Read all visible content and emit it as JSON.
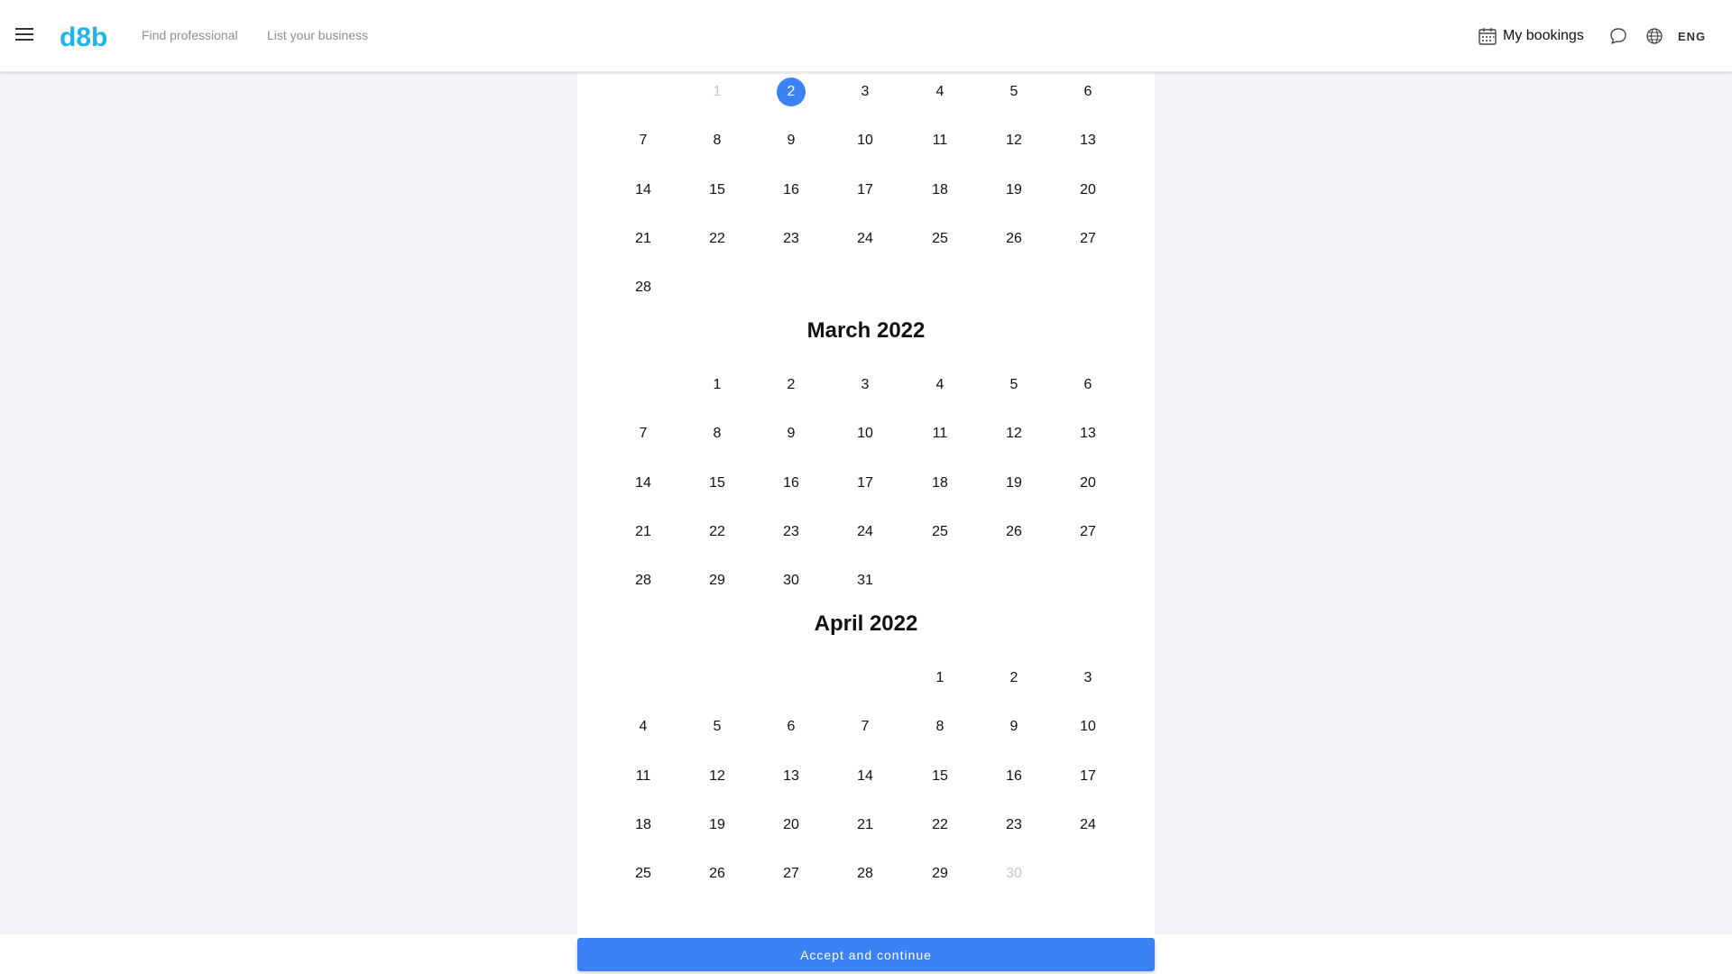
{
  "header": {
    "logo_text": "d8b",
    "nav": {
      "find_professional": "Find professional",
      "list_business": "List your business"
    },
    "my_bookings": "My bookings",
    "language": "ENG",
    "icons": {
      "menu": "hamburger-menu-icon",
      "bookings": "calendar-icon",
      "chat": "chat-icon",
      "language": "globe-icon"
    }
  },
  "colors": {
    "brand": "#1fb6e6",
    "accent": "#3b82f6",
    "disabled_text": "#c8c8c8",
    "background": "#f2f4f8"
  },
  "calendar": {
    "months": [
      {
        "title": "",
        "leading_blanks": 1,
        "days": 28,
        "disabled_days": [
          1
        ],
        "selected_day": 2
      },
      {
        "title": "March 2022",
        "leading_blanks": 1,
        "days": 31,
        "disabled_days": [],
        "selected_day": null
      },
      {
        "title": "April 2022",
        "leading_blanks": 4,
        "days": 30,
        "disabled_days": [
          30
        ],
        "selected_day": null
      }
    ]
  },
  "footer": {
    "accept_label": "Accept and continue"
  }
}
